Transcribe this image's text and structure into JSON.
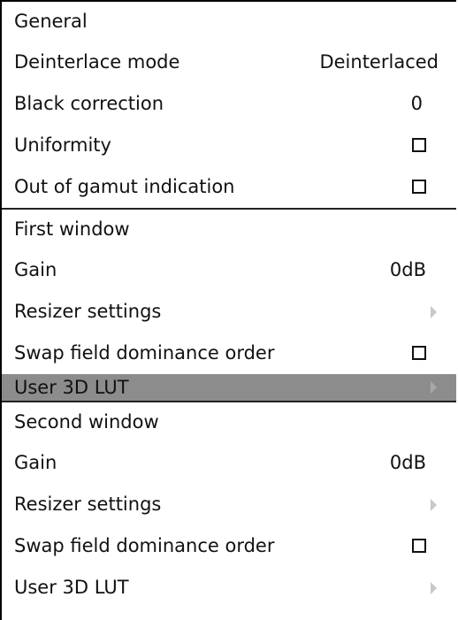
{
  "sections": {
    "general": {
      "header": "General",
      "deinterlace_label": "Deinterlace mode",
      "deinterlace_value": "Deinterlaced",
      "black_correction_label": "Black correction",
      "black_correction_value": "0",
      "uniformity_label": "Uniformity",
      "uniformity_checked": false,
      "gamut_label": "Out of gamut indication",
      "gamut_checked": false
    },
    "first_window": {
      "header": "First window",
      "gain_label": "Gain",
      "gain_value": "0dB",
      "resizer_label": "Resizer settings",
      "swap_label": "Swap field dominance order",
      "swap_checked": false,
      "lut_label": "User 3D LUT",
      "lut_selected": true
    },
    "second_window": {
      "header": "Second window",
      "gain_label": "Gain",
      "gain_value": "0dB",
      "resizer_label": "Resizer settings",
      "swap_label": "Swap field dominance order",
      "swap_checked": false,
      "lut_label": "User 3D LUT"
    }
  },
  "colors": {
    "highlight": "#8c8c8c",
    "text": "#111111",
    "submenu_arrow": "#c8c8c8"
  }
}
